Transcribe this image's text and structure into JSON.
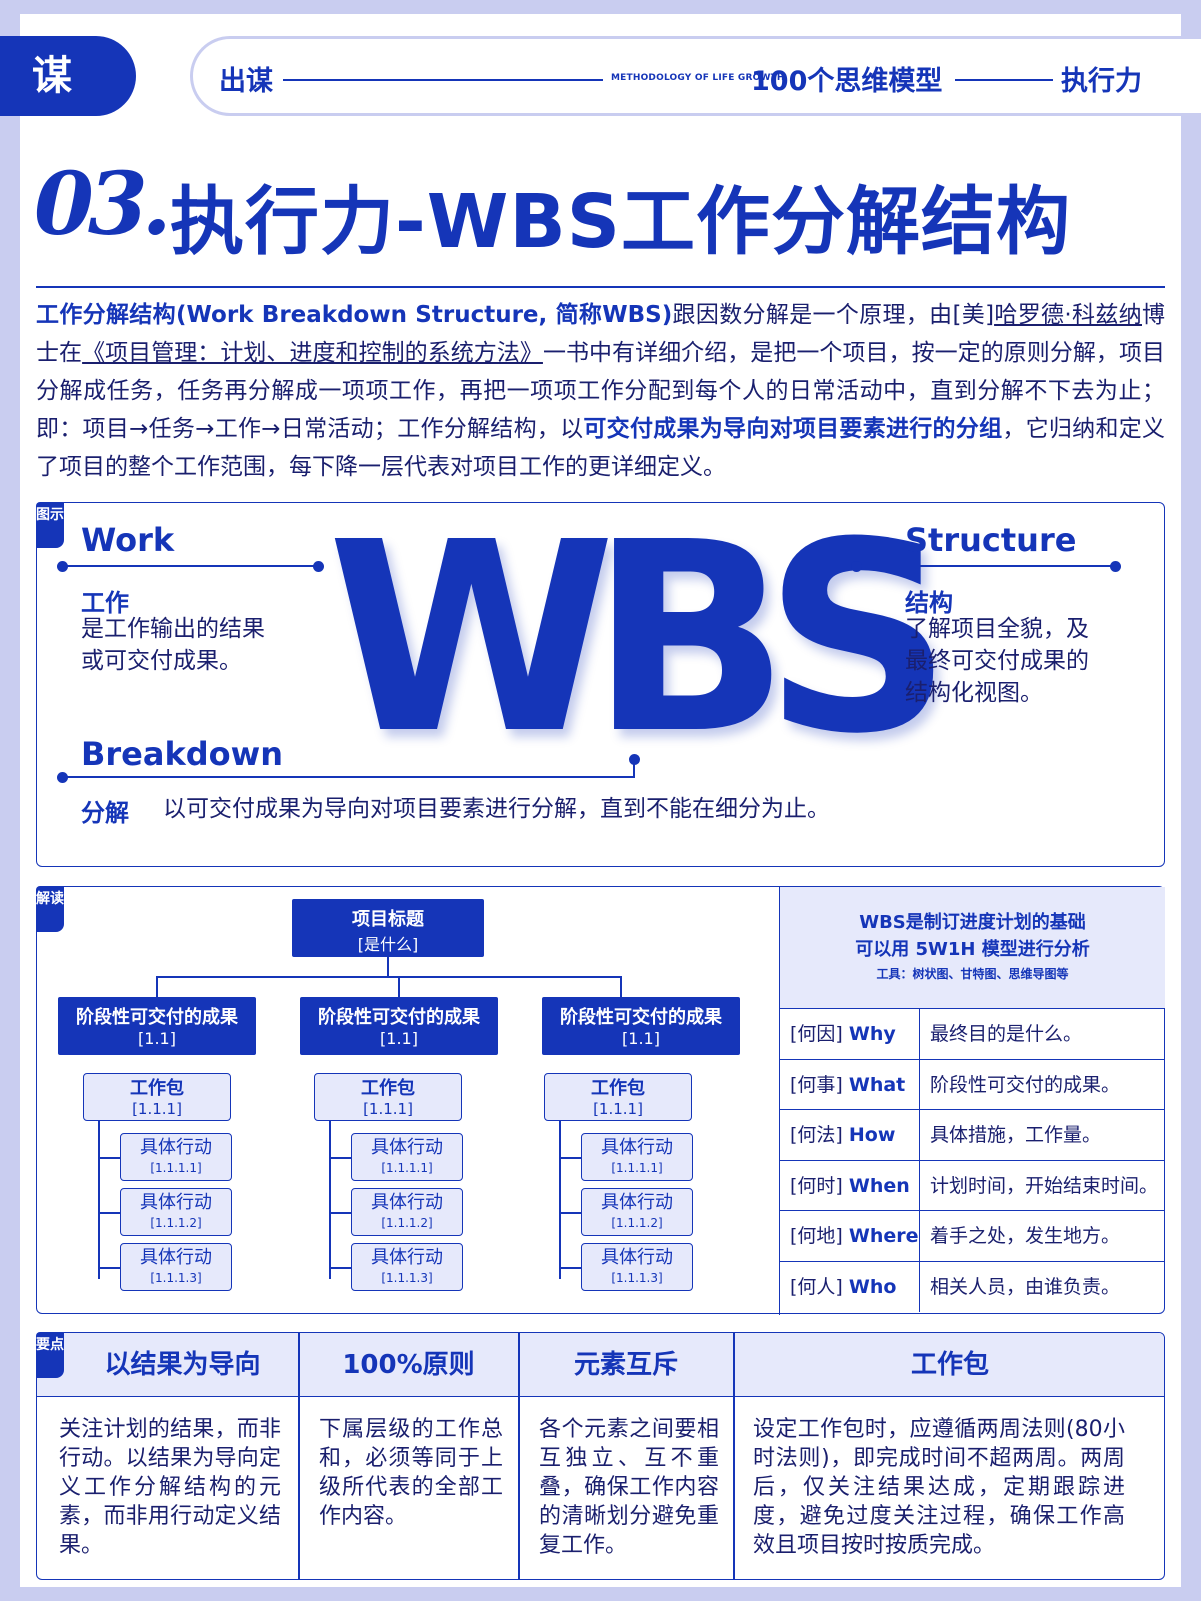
{
  "header": {
    "logo": "谋",
    "left": "出谋",
    "methodology": "METHODOLOGY OF LIFE GROWTH",
    "center": "100个思维模型",
    "right": "执行力"
  },
  "title": {
    "number": "03.",
    "text": "执行力-WBS工作分解结构"
  },
  "intro": {
    "p1": "工作分解结构(Work  Breakdown  Structure, 简称WBS)",
    "p2": "跟因数分解是一个原理，由[美]",
    "p3": "哈罗德·科兹纳",
    "p4": "博士在",
    "p5": "《项目管理：计划、进度和控制的系统方法》",
    "p6": "一书中有详细介绍，是把一个项目，按一定的原则分解，项目分解成任务，任务再分解成一项项工作，再把一项项工作分配到每个人的日常活动中，直到分解不下去为止；即：项目→任务→工作→日常活动；工作分解结构，以",
    "p7": "可交付成果为导向对项目要素进行的分组",
    "p8": "，它归纳和定义了项目的整个工作范围，每下降一层代表对项目工作的更详细定义。"
  },
  "diagram": {
    "tag": "图示",
    "big": "WBS",
    "work": {
      "en": "Work",
      "cn": "工作",
      "desc1": "是工作输出的结果",
      "desc2": "或可交付成果。"
    },
    "structure": {
      "en": "Structure",
      "cn": "结构",
      "desc1": "了解项目全貌，及",
      "desc2": "最终可交付成果的",
      "desc3": "结构化视图。"
    },
    "breakdown": {
      "en": "Breakdown",
      "cn": "分解",
      "desc": "以可交付成果为导向对项目要素进行分解，直到不能在细分为止。"
    }
  },
  "tree": {
    "tag": "解读",
    "root": {
      "title": "项目标题",
      "sub": "[是什么]"
    },
    "phase": {
      "title": "阶段性可交付的成果",
      "code": "[1.1]"
    },
    "package": {
      "title": "工作包",
      "code": "[1.1.1]"
    },
    "actions": [
      {
        "title": "具体行动",
        "code": "[1.1.1.1]"
      },
      {
        "title": "具体行动",
        "code": "[1.1.1.2]"
      },
      {
        "title": "具体行动",
        "code": "[1.1.1.3]"
      }
    ]
  },
  "table": {
    "head1": "WBS是制订进度计划的基础",
    "head2": "可以用 5W1H 模型进行分析",
    "tools": "工具：树状图、甘特图、思维导图等",
    "rows": [
      {
        "k1": "[何因]",
        "k2": "Why",
        "v": "最终目的是什么。"
      },
      {
        "k1": "[何事]",
        "k2": "What",
        "v": "阶段性可交付的成果。"
      },
      {
        "k1": "[何法]",
        "k2": "How",
        "v": "具体措施，工作量。"
      },
      {
        "k1": "[何时]",
        "k2": "When",
        "v": "计划时间，开始结束时间。"
      },
      {
        "k1": "[何地]",
        "k2": "Where",
        "v": "着手之处，发生地方。"
      },
      {
        "k1": "[何人]",
        "k2": "Who",
        "v": "相关人员，由谁负责。"
      }
    ]
  },
  "points": {
    "tag": "要点",
    "cols": [
      {
        "h": "以结果为导向",
        "b": "关注计划的结果，而非行动。以结果为导向定义工作分解结构的元素，而非用行动定义结果。"
      },
      {
        "h": "100%原则",
        "b": "下属层级的工作总和，必须等同于上级所代表的全部工作内容。"
      },
      {
        "h": "元素互斥",
        "b": "各个元素之间要相互独立、互不重叠，确保工作内容的清晰划分避免重复工作。"
      },
      {
        "h": "工作包",
        "b": "设定工作包时，应遵循两周法则(80小时法则)，即完成时间不超两周。两周后，仅关注结果达成，定期跟踪进度，避免过度关注过程，确保工作高效且项目按时按质完成。"
      }
    ]
  },
  "colors": {
    "brand": "#1535b8",
    "light": "#e6e9fb",
    "frame": "#c9cdf0"
  }
}
